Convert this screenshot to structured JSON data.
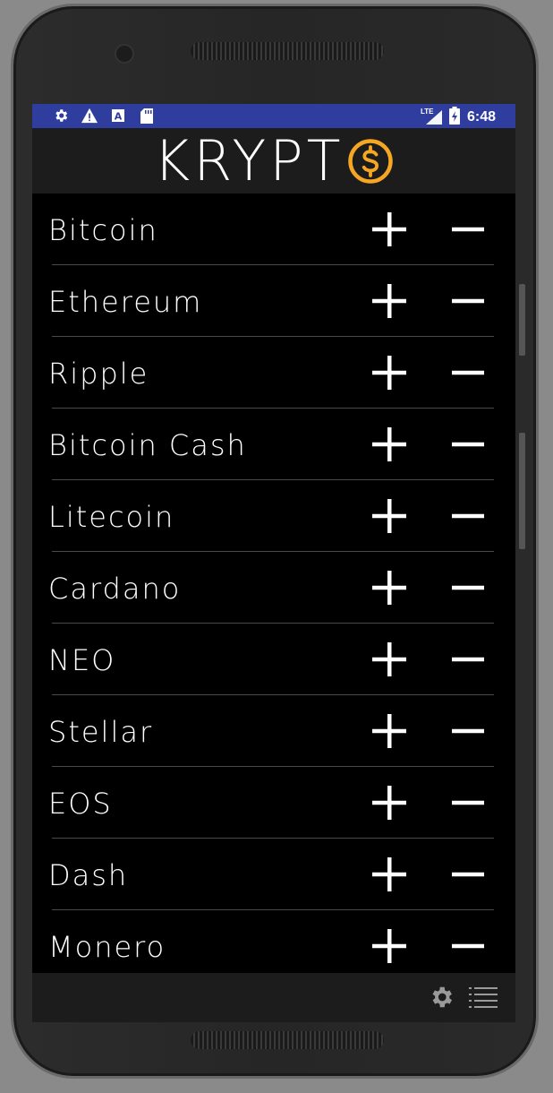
{
  "status_bar": {
    "time": "6:48",
    "left_icons": [
      "settings-icon",
      "warning-icon",
      "a-box-icon",
      "sd-card-icon"
    ],
    "network": "LTE",
    "right_icons": [
      "signal-icon",
      "battery-icon"
    ]
  },
  "app": {
    "title": "KRYPT",
    "logo": "dollar-coin-icon",
    "accent_color": "#f5a623",
    "status_bar_color": "#2f3d9e"
  },
  "coins": [
    {
      "name": "Bitcoin"
    },
    {
      "name": "Ethereum"
    },
    {
      "name": "Ripple"
    },
    {
      "name": "Bitcoin Cash"
    },
    {
      "name": "Litecoin"
    },
    {
      "name": "Cardano"
    },
    {
      "name": "NEO"
    },
    {
      "name": "Stellar"
    },
    {
      "name": "EOS"
    },
    {
      "name": "Dash"
    },
    {
      "name": "Monero"
    }
  ],
  "row_actions": [
    "plus-icon",
    "minus-icon"
  ],
  "bottom_nav": [
    "gear-icon",
    "list-icon"
  ]
}
